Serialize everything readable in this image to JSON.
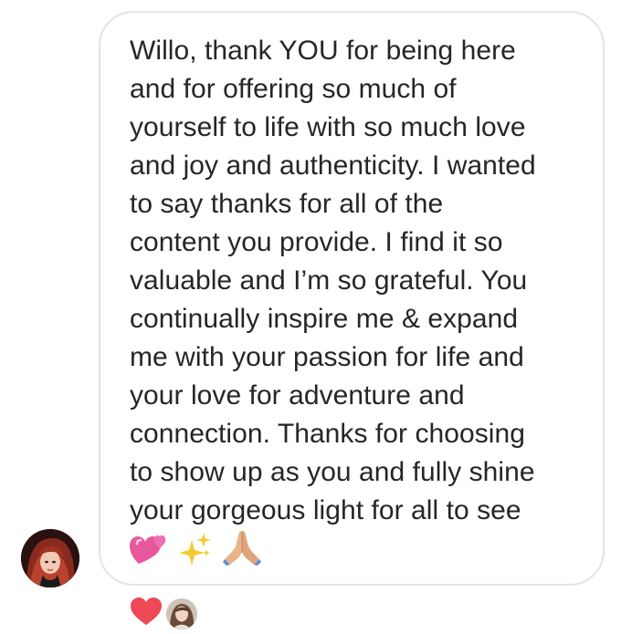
{
  "message": {
    "text": "Willo, thank YOU for being here\nand for offering so much of\nyourself to life with so much love\nand joy and authenticity. I wanted\nto say thanks for all of the\ncontent you provide. I find it so\nvaluable and I’m so grateful. You\ncontinually inspire me  & expand\nme with your passion for life and\nyour love for adventure and\nconnection. Thanks for choosing\nto show up as you and fully shine\nyour gorgeous light for all to see",
    "emojis": [
      "two-hearts",
      "sparkles",
      "folded-hands"
    ]
  },
  "sender": {
    "avatar": "profile-photo-red-hair"
  },
  "reactions": {
    "emoji": "red-heart",
    "reactor_avatar": "profile-photo"
  },
  "colors": {
    "text": "#262626",
    "bubble_border": "#e3e3e3",
    "heart": "#ed4956"
  }
}
